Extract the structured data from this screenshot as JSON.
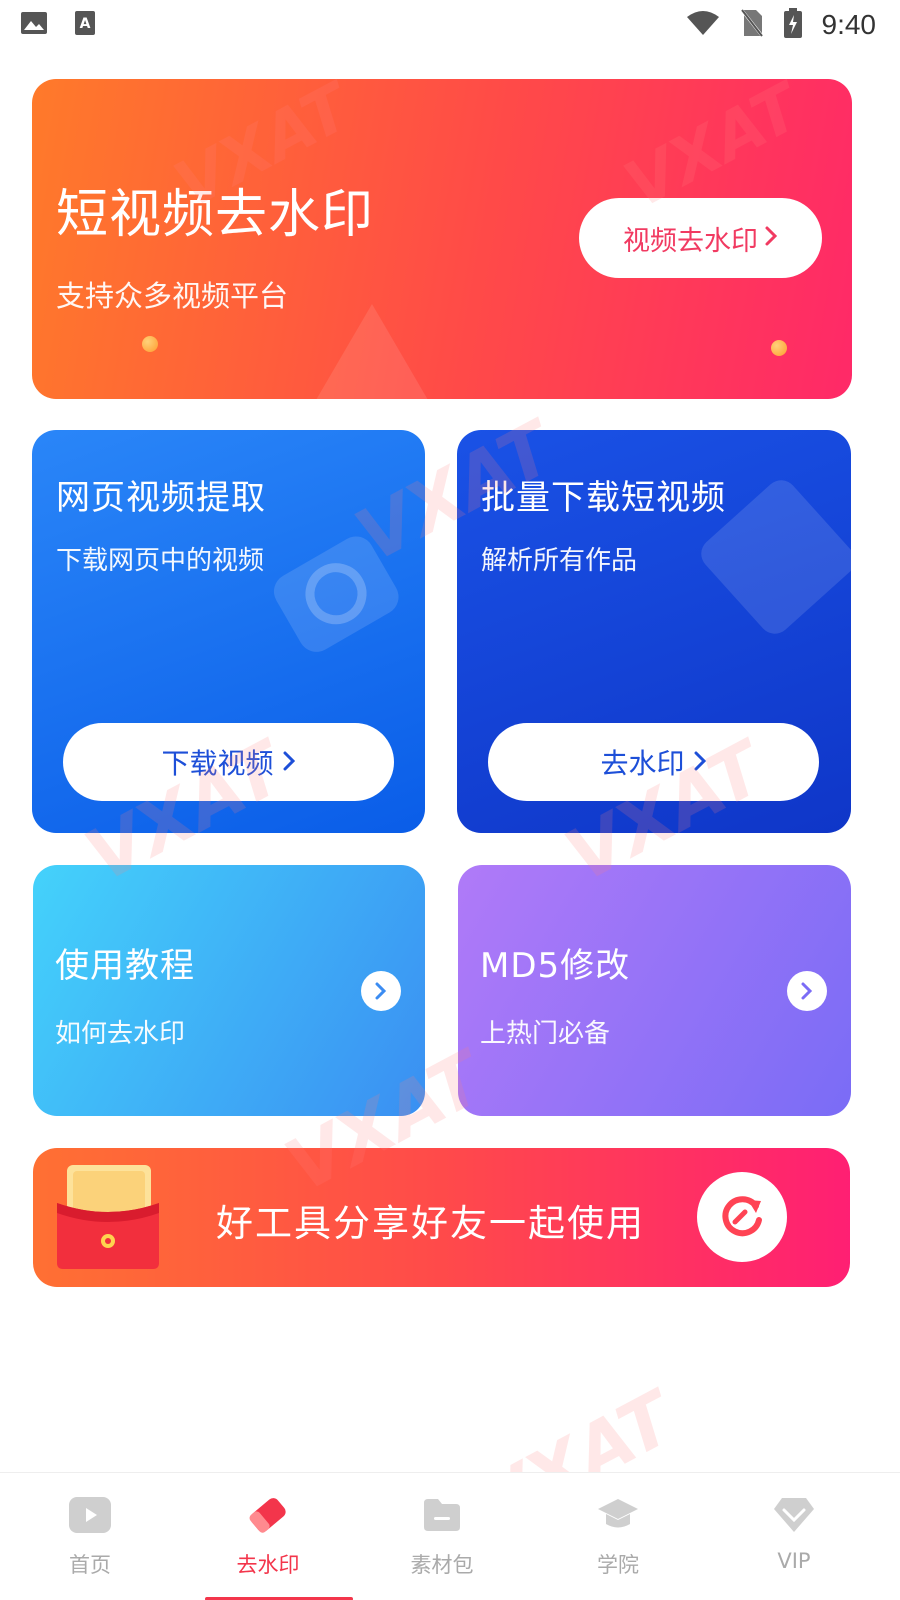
{
  "status_bar": {
    "time": "9:40",
    "left_icons": [
      "image-icon",
      "text-a-icon"
    ],
    "right_icons": [
      "wifi-icon",
      "no-sim-icon",
      "battery-charging-icon"
    ]
  },
  "hero": {
    "title": "短视频去水印",
    "subtitle": "支持众多视频平台",
    "button_label": "视频去水印"
  },
  "web_extract": {
    "title": "网页视频提取",
    "subtitle": "下载网页中的视频",
    "button_label": "下载视频"
  },
  "batch_download": {
    "title": "批量下载短视频",
    "subtitle": "解析所有作品",
    "button_label": "去水印"
  },
  "tutorial": {
    "title": "使用教程",
    "subtitle": "如何去水印"
  },
  "md5": {
    "title": "MD5修改",
    "subtitle": "上热门必备"
  },
  "share": {
    "text": "好工具分享好友一起使用"
  },
  "bottom_nav": {
    "items": [
      {
        "label": "首页",
        "icon": "home-video-icon",
        "active": false
      },
      {
        "label": "去水印",
        "icon": "eraser-icon",
        "active": true
      },
      {
        "label": "素材包",
        "icon": "folder-icon",
        "active": false
      },
      {
        "label": "学院",
        "icon": "graduation-cap-icon",
        "active": false
      },
      {
        "label": "VIP",
        "icon": "diamond-icon",
        "active": false
      }
    ]
  },
  "watermark": "VXAT",
  "colors": {
    "accent_red": "#f3354b",
    "hero_gradient": [
      "#ff7a2a",
      "#ff2968"
    ],
    "blue_card": [
      "#2a86f8",
      "#0a5de8"
    ],
    "deep_blue_card": [
      "#1a52e6",
      "#0f36c8"
    ],
    "cyan_card": [
      "#44d2fb",
      "#3a8ff2"
    ],
    "purple_card": [
      "#b07af8",
      "#7a6cf6"
    ]
  }
}
